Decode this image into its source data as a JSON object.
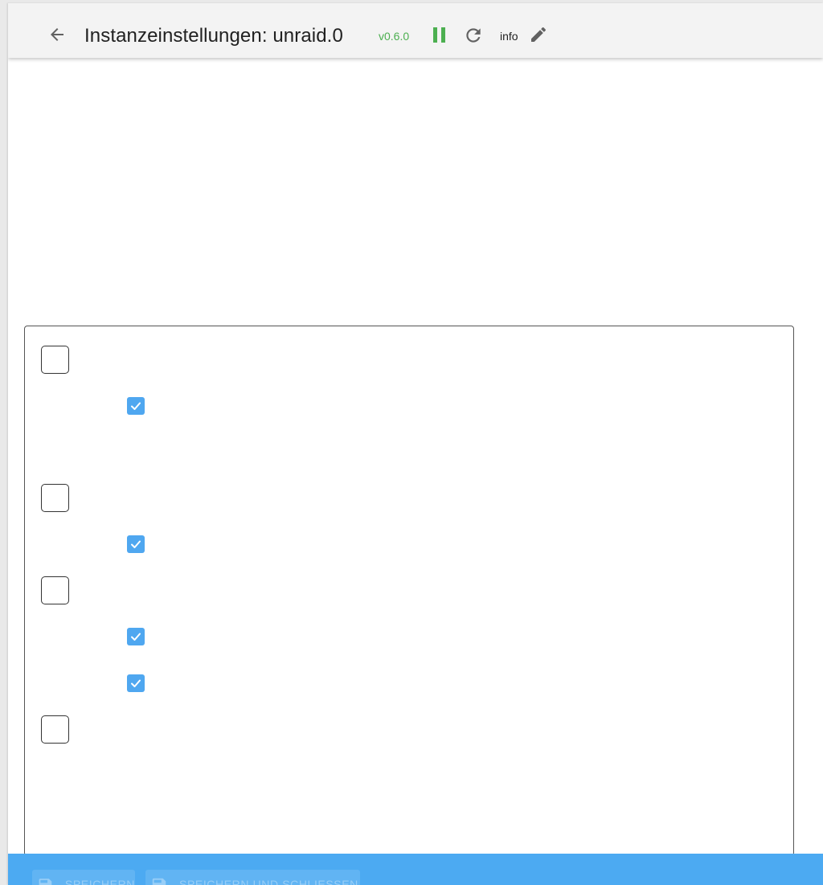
{
  "toolbar": {
    "title": "Instanzeinstellungen: unraid.0",
    "version": "v0.6.0",
    "info_label": "info",
    "icons": {
      "back": "arrow-back-icon",
      "pause": "pause-icon",
      "reload": "reload-icon",
      "edit": "pencil-icon"
    },
    "colors": {
      "version": "#4caf50",
      "pause": "#4caf50",
      "icon": "#616161"
    }
  },
  "settings": {
    "groups": [
      {
        "checked": false,
        "children": [
          {
            "checked": true
          }
        ]
      },
      {
        "checked": false,
        "children": [
          {
            "checked": true
          }
        ]
      },
      {
        "checked": false,
        "children": [
          {
            "checked": true
          },
          {
            "checked": true
          }
        ]
      },
      {
        "checked": false,
        "children": []
      }
    ],
    "checkbox_color": "#4fa7f0"
  },
  "footer": {
    "save_label": "SPEICHERN",
    "save_close_label": "SPEICHERN UND SCHLIESSEN",
    "icon": "save-icon",
    "bar_color": "#4caaf2"
  }
}
